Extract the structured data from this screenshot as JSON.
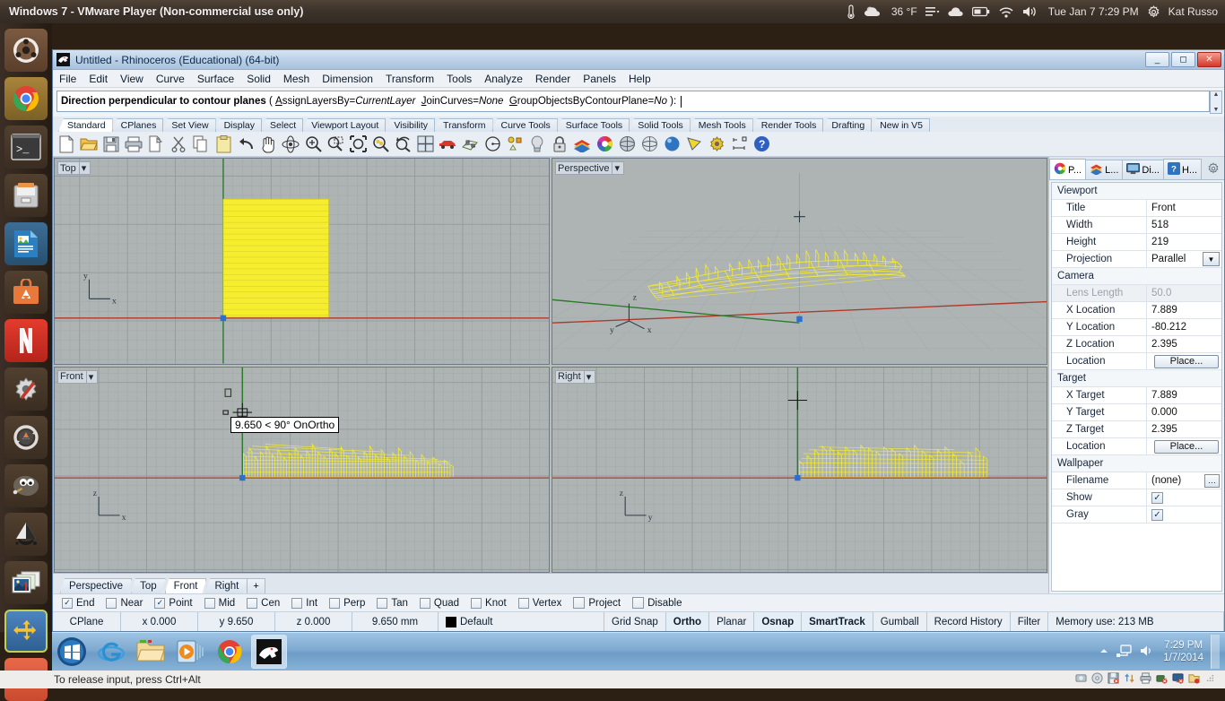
{
  "host": {
    "title": "Windows 7 - VMware Player (Non-commercial use only)",
    "tray": {
      "temperature": "36 °F",
      "datetime": "Tue Jan 7  7:29 PM",
      "user": "Kat Russo",
      "icons": [
        "thermometer-icon",
        "weather-cloud-icon",
        "menu-icon",
        "cloud-icon",
        "battery-icon",
        "wifi-icon",
        "volume-icon",
        "gear-icon"
      ]
    },
    "status_message": "To release input, press Ctrl+Alt"
  },
  "launcher": {
    "items": [
      {
        "name": "ubuntu-dash",
        "label": "Ubuntu Dash"
      },
      {
        "name": "google-chrome",
        "label": "Google Chrome"
      },
      {
        "name": "terminal",
        "label": "Terminal"
      },
      {
        "name": "files",
        "label": "Files"
      },
      {
        "name": "libreoffice-writer",
        "label": "LibreOffice Writer"
      },
      {
        "name": "software-center",
        "label": "Ubuntu Software Center"
      },
      {
        "name": "netflix",
        "label": "Netflix"
      },
      {
        "name": "system-settings",
        "label": "System Settings"
      },
      {
        "name": "software-updater",
        "label": "Software Updater"
      },
      {
        "name": "gimp",
        "label": "GIMP"
      },
      {
        "name": "inkscape",
        "label": "Inkscape"
      },
      {
        "name": "shotwell",
        "label": "Shotwell"
      },
      {
        "name": "vmware-player",
        "label": "VMware Player"
      },
      {
        "name": "unity-app",
        "label": "Unity"
      }
    ]
  },
  "rhino": {
    "window_title": "Untitled - Rhinoceros (Educational) (64-bit)",
    "window_buttons": [
      "minimize",
      "maximize",
      "close"
    ],
    "menus": [
      "File",
      "Edit",
      "View",
      "Curve",
      "Surface",
      "Solid",
      "Mesh",
      "Dimension",
      "Transform",
      "Tools",
      "Analyze",
      "Render",
      "Panels",
      "Help"
    ],
    "command_line": {
      "prompt": "Direction perpendicular to contour planes",
      "open_paren": "(",
      "options": [
        {
          "key": "A",
          "rest": "ssignLayersBy=",
          "value": "CurrentLayer"
        },
        {
          "key": "J",
          "rest": "oinCurves=",
          "value": "None"
        },
        {
          "key": "G",
          "rest": "roupObjectsByContourPlane=",
          "value": "No"
        }
      ],
      "close_paren": "):"
    },
    "toolbar_tabs": [
      "Standard",
      "CPlanes",
      "Set View",
      "Display",
      "Select",
      "Viewport Layout",
      "Visibility",
      "Transform",
      "Curve Tools",
      "Surface Tools",
      "Solid Tools",
      "Mesh Tools",
      "Render Tools",
      "Drafting",
      "New in V5"
    ],
    "active_toolbar_tab": "Standard",
    "toolbar_icons": [
      "new-file-icon",
      "open-folder-icon",
      "save-icon",
      "print-icon",
      "copy-to-clipboard-icon",
      "cut-icon",
      "copy-icon",
      "paste-icon",
      "undo-icon",
      "pan-icon",
      "rotate-view-icon",
      "zoom-in-icon",
      "zoom-window-icon",
      "zoom-extents-icon",
      "zoom-selected-icon",
      "zoom-previous-icon",
      "four-viewport-icon",
      "car-render-icon",
      "surface-from-points-icon",
      "circle-icon",
      "point-objects-icon",
      "light-bulb-icon",
      "lock-icon",
      "layers-icon",
      "color-wheel-icon",
      "shaded-sphere-icon",
      "ghosted-sphere-icon",
      "rendered-sphere-icon",
      "flat-shade-icon",
      "options-gear-icon",
      "dimension-icon",
      "help-icon"
    ],
    "viewports": [
      {
        "name": "Top",
        "label": "Top"
      },
      {
        "name": "Perspective",
        "label": "Perspective"
      },
      {
        "name": "Front",
        "label": "Front"
      },
      {
        "name": "Right",
        "label": "Right"
      }
    ],
    "front_tooltip": "9.650 < 90° OnOrtho",
    "viewport_tabs": [
      "Perspective",
      "Top",
      "Front",
      "Right"
    ],
    "active_viewport_tab": "Front",
    "viewport_tab_add": "+",
    "properties": {
      "tabs": [
        {
          "name": "properties-tab",
          "label": "P...",
          "icon": "color-wheel-icon",
          "active": true
        },
        {
          "name": "layers-tab",
          "label": "L...",
          "icon": "layers-icon",
          "active": false
        },
        {
          "name": "display-tab",
          "label": "Di...",
          "icon": "monitor-icon",
          "active": false
        },
        {
          "name": "help-tab",
          "label": "H...",
          "icon": "help-icon",
          "active": false
        }
      ],
      "sections": [
        {
          "title": "Viewport",
          "rows": [
            {
              "name": "Title",
              "value": "Front",
              "type": "text"
            },
            {
              "name": "Width",
              "value": "518",
              "type": "text"
            },
            {
              "name": "Height",
              "value": "219",
              "type": "text"
            },
            {
              "name": "Projection",
              "value": "Parallel",
              "type": "dropdown"
            }
          ]
        },
        {
          "title": "Camera",
          "rows": [
            {
              "name": "Lens Length",
              "value": "50.0",
              "type": "text",
              "disabled": true
            },
            {
              "name": "X Location",
              "value": "7.889",
              "type": "text"
            },
            {
              "name": "Y Location",
              "value": "-80.212",
              "type": "text"
            },
            {
              "name": "Z Location",
              "value": "2.395",
              "type": "text"
            },
            {
              "name": "Location",
              "value": "Place...",
              "type": "button"
            }
          ]
        },
        {
          "title": "Target",
          "rows": [
            {
              "name": "X Target",
              "value": "7.889",
              "type": "text"
            },
            {
              "name": "Y Target",
              "value": "0.000",
              "type": "text"
            },
            {
              "name": "Z Target",
              "value": "2.395",
              "type": "text"
            },
            {
              "name": "Location",
              "value": "Place...",
              "type": "button"
            }
          ]
        },
        {
          "title": "Wallpaper",
          "rows": [
            {
              "name": "Filename",
              "value": "(none)",
              "type": "file"
            },
            {
              "name": "Show",
              "value": "checked",
              "type": "checkbox"
            },
            {
              "name": "Gray",
              "value": "checked",
              "type": "checkbox"
            }
          ]
        }
      ]
    },
    "osnap": [
      {
        "label": "End",
        "checked": true
      },
      {
        "label": "Near",
        "checked": false
      },
      {
        "label": "Point",
        "checked": true
      },
      {
        "label": "Mid",
        "checked": false
      },
      {
        "label": "Cen",
        "checked": false
      },
      {
        "label": "Int",
        "checked": false
      },
      {
        "label": "Perp",
        "checked": false
      },
      {
        "label": "Tan",
        "checked": false
      },
      {
        "label": "Quad",
        "checked": false
      },
      {
        "label": "Knot",
        "checked": false
      },
      {
        "label": "Vertex",
        "checked": false
      },
      {
        "label": "Project",
        "checked": false
      },
      {
        "label": "Disable",
        "checked": false
      }
    ],
    "statusbar": {
      "cplane": "CPlane",
      "x": "x 0.000",
      "y": "y 9.650",
      "z": "z 0.000",
      "distance": "9.650 mm",
      "layer": "Default",
      "layer_color": "#000000",
      "toggles": [
        {
          "label": "Grid Snap",
          "on": false
        },
        {
          "label": "Ortho",
          "on": true
        },
        {
          "label": "Planar",
          "on": false
        },
        {
          "label": "Osnap",
          "on": true
        },
        {
          "label": "SmartTrack",
          "on": true
        },
        {
          "label": "Gumball",
          "on": false
        },
        {
          "label": "Record History",
          "on": false
        },
        {
          "label": "Filter",
          "on": false
        }
      ],
      "memory": "Memory use: 213 MB"
    }
  },
  "windows_taskbar": {
    "start": "start-orb-icon",
    "items": [
      {
        "name": "internet-explorer",
        "label": "Internet Explorer",
        "active": false
      },
      {
        "name": "windows-explorer",
        "label": "Windows Explorer",
        "active": false
      },
      {
        "name": "windows-media-player",
        "label": "Windows Media Player",
        "active": false
      },
      {
        "name": "google-chrome",
        "label": "Google Chrome",
        "active": false
      },
      {
        "name": "rhinoceros",
        "label": "Rhinoceros",
        "active": true
      }
    ],
    "tray_icons": [
      "show-hidden-icon",
      "network-icon",
      "volume-icon"
    ],
    "clock_time": "7:29 PM",
    "clock_date": "1/7/2014"
  }
}
